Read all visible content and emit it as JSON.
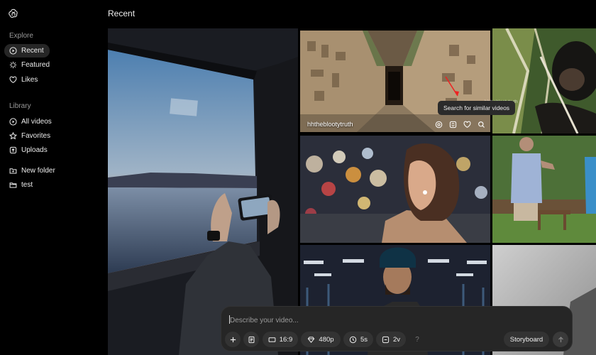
{
  "header": {
    "title": "Recent"
  },
  "sidebar": {
    "explore_label": "Explore",
    "library_label": "Library",
    "explore": [
      {
        "label": "Recent",
        "icon": "play-circle-icon",
        "active": true
      },
      {
        "label": "Featured",
        "icon": "sparkle-icon"
      },
      {
        "label": "Likes",
        "icon": "heart-icon"
      }
    ],
    "library": [
      {
        "label": "All videos",
        "icon": "play-circle-icon"
      },
      {
        "label": "Favorites",
        "icon": "star-icon"
      },
      {
        "label": "Uploads",
        "icon": "upload-icon"
      }
    ],
    "folders": [
      {
        "label": "New folder",
        "icon": "folder-add-icon"
      },
      {
        "label": "test",
        "icon": "folder-icon"
      }
    ]
  },
  "grid": {
    "hovered_tile": {
      "author": "hhtheblootytruth",
      "tooltip": "Search for similar videos"
    }
  },
  "composer": {
    "placeholder": "Describe your video...",
    "aspect": "16:9",
    "resolution": "480p",
    "duration": "5s",
    "variations": "2v",
    "help": "?",
    "storyboard_label": "Storyboard"
  }
}
